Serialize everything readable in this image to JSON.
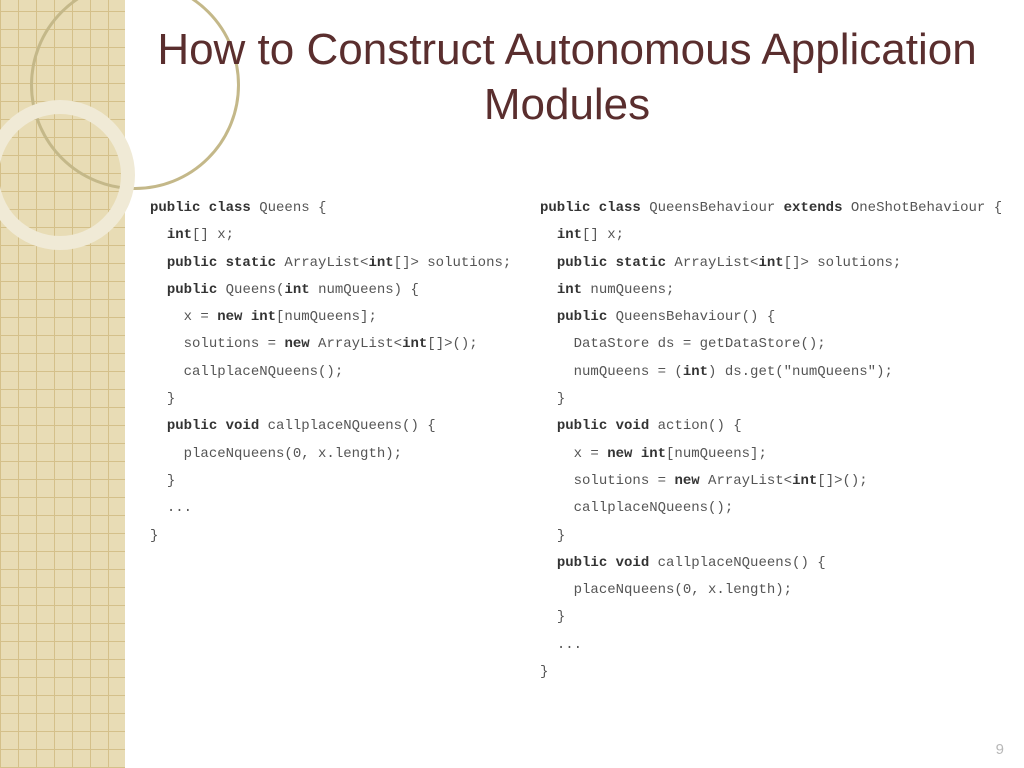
{
  "title": "How to Construct Autonomous Application Modules",
  "pageNumber": "9",
  "codeLeft": {
    "l1a": "public class",
    "l1b": " Queens {",
    "l2a": "int",
    "l2b": "[] x;",
    "l3a": "public static",
    "l3b": " ArrayList<",
    "l3c": "int",
    "l3d": "[]> solutions;",
    "l4a": "public",
    "l4b": " Queens(",
    "l4c": "int",
    "l4d": " numQueens) {",
    "l5a": "x = ",
    "l5b": "new int",
    "l5c": "[numQueens];",
    "l6a": "solutions = ",
    "l6b": "new",
    "l6c": " ArrayList<",
    "l6d": "int",
    "l6e": "[]>();",
    "l7": "callplaceNQueens();",
    "l8": "}",
    "l9a": "public void",
    "l9b": " callplaceNQueens() {",
    "l10": "placeNqueens(0, x.length);",
    "l11": "}",
    "l12": "...",
    "l13": "}"
  },
  "codeRight": {
    "l1a": "public class",
    "l1b": " QueensBehaviour ",
    "l1c": "extends",
    "l1d": " OneShotBehaviour {",
    "l2a": "int",
    "l2b": "[] x;",
    "l3a": "public static",
    "l3b": " ArrayList<",
    "l3c": "int",
    "l3d": "[]> solutions;",
    "l4a": "int",
    "l4b": " numQueens;",
    "l5a": "public",
    "l5b": " QueensBehaviour() {",
    "l6": "DataStore ds = getDataStore();",
    "l7a": "numQueens = (",
    "l7b": "int",
    "l7c": ") ds.get(\"numQueens\");",
    "l8": "}",
    "l9a": "public void",
    "l9b": " action() {",
    "l10a": "x = ",
    "l10b": "new int",
    "l10c": "[numQueens];",
    "l11a": "solutions = ",
    "l11b": "new",
    "l11c": " ArrayList<",
    "l11d": "int",
    "l11e": "[]>();",
    "l12": "callplaceNQueens();",
    "l13": "}",
    "l14a": "public void",
    "l14b": " callplaceNQueens() {",
    "l15": "placeNqueens(0, x.length);",
    "l16": "}",
    "l17": "...",
    "l18": "}"
  }
}
